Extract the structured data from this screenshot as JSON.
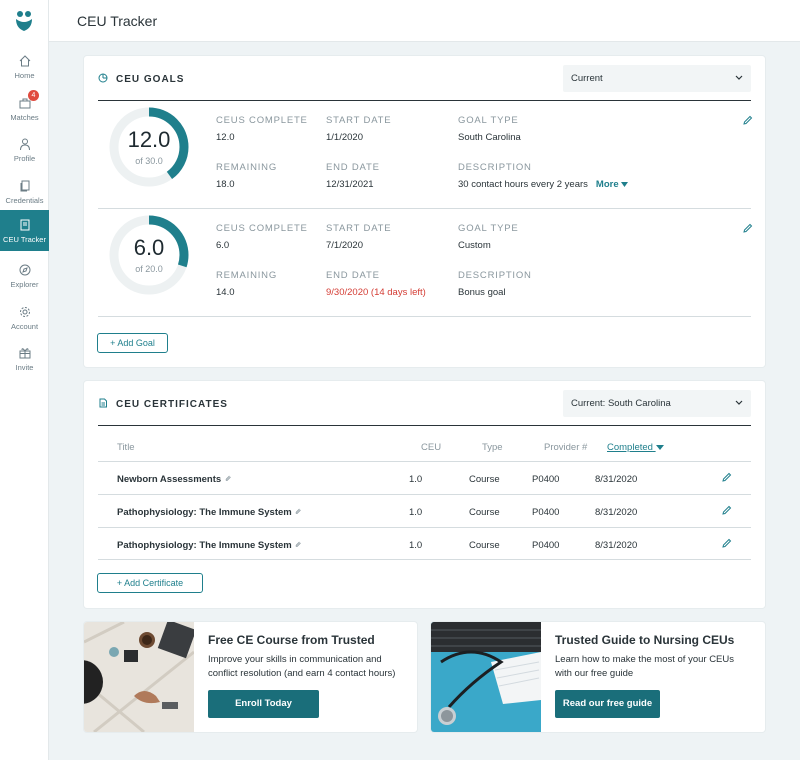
{
  "header": {
    "title": "CEU Tracker"
  },
  "sidebar": {
    "items": [
      {
        "label": "Home",
        "icon": "home-icon"
      },
      {
        "label": "Matches",
        "icon": "briefcase-icon",
        "badge": "4"
      },
      {
        "label": "Profile",
        "icon": "person-icon"
      },
      {
        "label": "Credentials",
        "icon": "documents-icon"
      },
      {
        "label": "CEU Tracker",
        "icon": "book-icon",
        "active": true
      },
      {
        "label": "Explorer",
        "icon": "compass-icon"
      },
      {
        "label": "Account",
        "icon": "gear-icon"
      },
      {
        "label": "Invite",
        "icon": "gift-icon"
      }
    ]
  },
  "goals": {
    "title": "CEU GOALS",
    "dropdown": "Current",
    "labels": {
      "complete": "CEUS COMPLETE",
      "remaining": "REMAINING",
      "start": "START DATE",
      "end": "END DATE",
      "type": "GOAL TYPE",
      "description": "DESCRIPTION"
    },
    "items": [
      {
        "ring_value": "12.0",
        "ring_total": "of 30.0",
        "progress": 0.4,
        "complete": "12.0",
        "remaining": "18.0",
        "start": "1/1/2020",
        "end": "12/31/2021",
        "end_overdue": false,
        "type": "South Carolina",
        "description": "30 contact hours every 2 years",
        "more": "More"
      },
      {
        "ring_value": "6.0",
        "ring_total": "of 20.0",
        "progress": 0.3,
        "complete": "6.0",
        "remaining": "14.0",
        "start": "7/1/2020",
        "end": "9/30/2020 (14 days left)",
        "end_overdue": true,
        "type": "Custom",
        "description": "Bonus goal"
      }
    ],
    "add_label": "+ Add Goal"
  },
  "certificates": {
    "title": "CEU CERTIFICATES",
    "dropdown": "Current: South Carolina",
    "columns": {
      "title": "Title",
      "ceu": "CEU",
      "type": "Type",
      "provider": "Provider #",
      "completed": "Completed"
    },
    "rows": [
      {
        "title": "Newborn Assessments",
        "ceu": "1.0",
        "type": "Course",
        "provider": "P0400",
        "completed": "8/31/2020"
      },
      {
        "title": "Pathophysiology: The Immune System",
        "ceu": "1.0",
        "type": "Course",
        "provider": "P0400",
        "completed": "8/31/2020"
      },
      {
        "title": "Pathophysiology: The Immune System",
        "ceu": "1.0",
        "type": "Course",
        "provider": "P0400",
        "completed": "8/31/2020"
      }
    ],
    "add_label": "+ Add Certificate"
  },
  "promos": [
    {
      "title": "Free CE Course from Trusted",
      "description": "Improve your skills in communication and conflict resolution (and earn 4 contact hours)",
      "button": "Enroll Today"
    },
    {
      "title": "Trusted Guide to Nursing CEUs",
      "description": "Learn how to make the most of your CEUs with our free guide",
      "button": "Read our free guide"
    }
  ],
  "colors": {
    "accent": "#1f7f8c",
    "danger": "#d43d35",
    "badge": "#e04b3f",
    "ring_track": "#edf1f2"
  }
}
